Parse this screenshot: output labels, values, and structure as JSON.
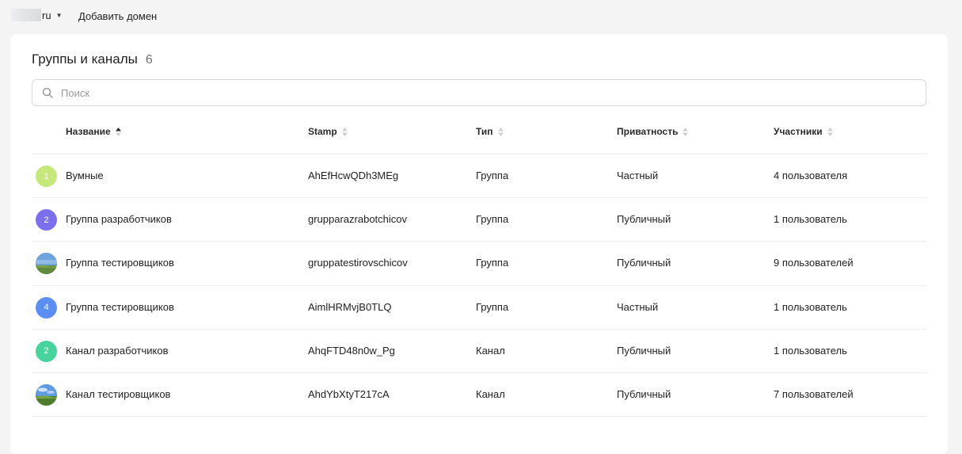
{
  "topbar": {
    "domain_suffix": "ru",
    "add_domain_label": "Добавить домен"
  },
  "section": {
    "title": "Группы и каналы",
    "count": "6"
  },
  "search": {
    "placeholder": "Поиск",
    "value": ""
  },
  "table": {
    "columns": [
      "Название",
      "Stamp",
      "Тип",
      "Приватность",
      "Участники"
    ],
    "sorted_column": "Название",
    "rows": [
      {
        "avatar_text": "1",
        "avatar_color": "#c6e87a",
        "avatar_kind": "text",
        "name": "Вумные",
        "stamp": "AhEfHcwQDh3MEg",
        "type": "Группа",
        "privacy": "Частный",
        "members": "4 пользователя"
      },
      {
        "avatar_text": "2",
        "avatar_color": "#7b6ff0",
        "avatar_kind": "text",
        "name": "Группа разработчиков",
        "stamp": "grupparazrabotchicov",
        "type": "Группа",
        "privacy": "Публичный",
        "members": "1 пользователь"
      },
      {
        "avatar_text": "",
        "avatar_color": "#6a9fd8",
        "avatar_kind": "landscape",
        "name": "Группа тестировщиков",
        "stamp": "gruppatestirovschicov",
        "type": "Группа",
        "privacy": "Публичный",
        "members": "9 пользователей"
      },
      {
        "avatar_text": "4",
        "avatar_color": "#5b8ef3",
        "avatar_kind": "text",
        "name": "Группа тестировщиков",
        "stamp": "AimlHRMvjB0TLQ",
        "type": "Группа",
        "privacy": "Частный",
        "members": "1 пользователь"
      },
      {
        "avatar_text": "2",
        "avatar_color": "#44d49c",
        "avatar_kind": "text",
        "name": "Канал разработчиков",
        "stamp": "AhqFTD48n0w_Pg",
        "type": "Канал",
        "privacy": "Публичный",
        "members": "1 пользователь"
      },
      {
        "avatar_text": "",
        "avatar_color": "#6a9fd8",
        "avatar_kind": "landscape",
        "name": "Канал тестировщиков",
        "stamp": "AhdYbXtyT217cA",
        "type": "Канал",
        "privacy": "Публичный",
        "members": "7 пользователей"
      }
    ]
  }
}
